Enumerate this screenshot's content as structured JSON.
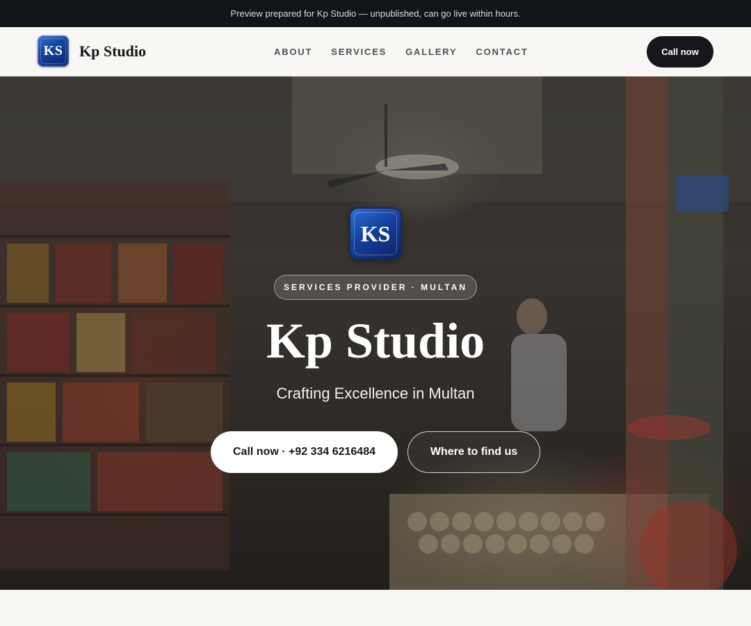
{
  "preview_banner": "Preview prepared for Kp Studio — unpublished, can go live within hours.",
  "header": {
    "logo_text": "KS",
    "brand_name": "Kp Studio",
    "nav": [
      "ABOUT",
      "SERVICES",
      "GALLERY",
      "CONTACT"
    ],
    "call_label": "Call now"
  },
  "hero": {
    "logo_text": "KS",
    "tagline": "SERVICES PROVIDER · MULTAN",
    "title": "Kp Studio",
    "subtitle": "Crafting Excellence in Multan",
    "primary_cta": "Call now · +92 334 6216484",
    "secondary_cta": "Where to find us",
    "background_image": "shop-interior-photo"
  },
  "colors": {
    "banner_bg": "#111418",
    "nav_bg": "#f8f7f3",
    "brand_blue": "#14409b",
    "dark_button": "#15171c"
  }
}
